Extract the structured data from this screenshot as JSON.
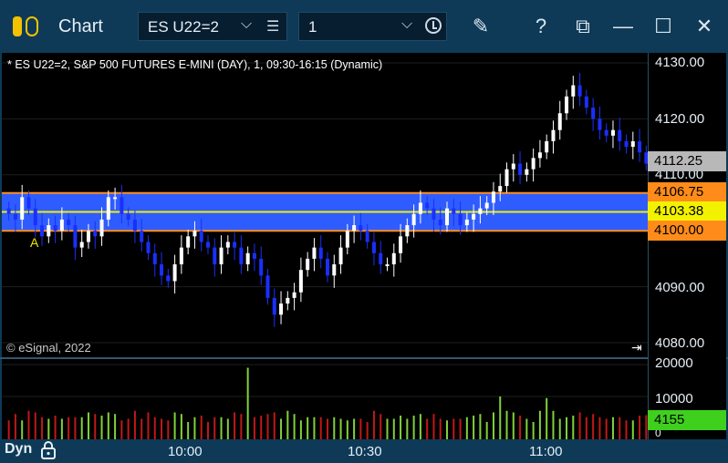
{
  "app": {
    "title": "Chart",
    "symbol": "ES U22=2",
    "interval": "1",
    "icons": [
      "pencil-icon",
      "help-icon",
      "window-icon",
      "minimize-icon",
      "maximize-icon",
      "close-icon"
    ]
  },
  "chart": {
    "caption": "* ES U22=2, S&P 500 FUTURES E-MINI (DAY), 1, 09:30-16:15 (Dynamic)",
    "copyright": "© eSignal, 2022",
    "marker": "A",
    "mode_label": "Dyn",
    "price_ticks": [
      "4130.00",
      "4120.00",
      "4110.00",
      "4090.00",
      "4080.00"
    ],
    "volume_ticks": [
      "20000",
      "10000",
      "0"
    ],
    "time_labels": [
      "10:00",
      "10:30",
      "11:00"
    ],
    "badges": {
      "last": "4112.25",
      "upper": "4106.75",
      "mid": "4103.38",
      "lower": "4100.00",
      "volume": "4155"
    },
    "colors": {
      "band": "#2f5cff",
      "band_edge": "#ff8c1a",
      "midline": "#f2f200",
      "up": "#ffffff",
      "down": "#1a2fff",
      "vol_up": "#7fd23a",
      "vol_down": "#c01818"
    }
  },
  "chart_data": {
    "type": "candlestick",
    "title": "* ES U22=2, S&P 500 FUTURES E-MINI (DAY), 1, 09:30-16:15 (Dynamic)",
    "ylim": [
      4079,
      4131
    ],
    "x": [
      "09:38",
      "09:39",
      "09:40",
      "09:41",
      "09:42",
      "09:43",
      "09:44",
      "09:45",
      "09:46",
      "09:47",
      "09:48",
      "09:49",
      "09:50",
      "09:51",
      "09:52",
      "09:53",
      "09:54",
      "09:55",
      "09:56",
      "09:57",
      "09:58",
      "09:59",
      "10:00",
      "10:01",
      "10:02",
      "10:03",
      "10:04",
      "10:05",
      "10:06",
      "10:07",
      "10:08",
      "10:09",
      "10:10",
      "10:11",
      "10:12",
      "10:13",
      "10:14",
      "10:15",
      "10:16",
      "10:17",
      "10:18",
      "10:19",
      "10:20",
      "10:21",
      "10:22",
      "10:23",
      "10:24",
      "10:25",
      "10:26",
      "10:27",
      "10:28",
      "10:29",
      "10:30",
      "10:31",
      "10:32",
      "10:33",
      "10:34",
      "10:35",
      "10:36",
      "10:37",
      "10:38",
      "10:39",
      "10:40",
      "10:41",
      "10:42",
      "10:43",
      "10:44",
      "10:45",
      "10:46",
      "10:47",
      "10:48",
      "10:49",
      "10:50",
      "10:51",
      "10:52",
      "10:53",
      "10:54",
      "10:55",
      "10:56",
      "10:57",
      "10:58",
      "10:59",
      "11:00",
      "11:01",
      "11:02",
      "11:03",
      "11:04",
      "11:05",
      "11:06",
      "11:07",
      "11:08",
      "11:09",
      "11:10",
      "11:11",
      "11:12",
      "11:13",
      "11:14"
    ],
    "close": [
      4103,
      4102,
      4106,
      4104,
      4101,
      4099,
      4101,
      4100,
      4102,
      4101,
      4097,
      4098,
      4100,
      4099,
      4102,
      4106,
      4106,
      4103,
      4102,
      4100,
      4098,
      4096,
      4094,
      4092,
      4091,
      4094,
      4097,
      4099,
      4100,
      4098,
      4097,
      4094,
      4097,
      4098,
      4097,
      4094,
      4096,
      4095,
      4092,
      4088,
      4085,
      4087,
      4088,
      4089,
      4093,
      4095,
      4097,
      4095,
      4092,
      4094,
      4097,
      4100,
      4101,
      4100,
      4098,
      4096,
      4094,
      4094,
      4096,
      4099,
      4101,
      4103,
      4105,
      4104,
      4102,
      4101,
      4104,
      4103,
      4101,
      4102,
      4103,
      4104,
      4105,
      4107,
      4108,
      4111,
      4112,
      4110,
      4111,
      4113,
      4114,
      4116,
      4118,
      4121,
      4124,
      4126,
      4124,
      4122,
      4120,
      4118,
      4117,
      4118,
      4116,
      4115,
      4116,
      4114,
      4112
    ],
    "volume": [
      2500,
      4500,
      2500,
      5500,
      5000,
      3500,
      3000,
      4000,
      3000,
      3500,
      3500,
      3500,
      5000,
      4500,
      4000,
      5000,
      4500,
      2500,
      3000,
      5500,
      3000,
      5000,
      3500,
      3000,
      2500,
      5000,
      4500,
      2000,
      3500,
      4000,
      2000,
      3500,
      3500,
      3000,
      5000,
      4500,
      19000,
      3500,
      4000,
      4500,
      5000,
      3000,
      5500,
      4500,
      2500,
      3500,
      3500,
      3500,
      3000,
      3500,
      3000,
      2500,
      3000,
      3000,
      2000,
      5500,
      4500,
      3000,
      3000,
      4000,
      3000,
      4000,
      4500,
      3000,
      4500,
      3000,
      2500,
      3000,
      3000,
      3500,
      4000,
      4500,
      2000,
      5000,
      10000,
      5500,
      5000,
      4000,
      3000,
      2000,
      5500,
      9500,
      5500,
      3000,
      3500,
      4000,
      5000,
      3500,
      4500,
      3500,
      3000,
      3500,
      3500,
      2500,
      2500,
      4000,
      4155
    ],
    "overlay_lines": {
      "upper": 4106.75,
      "mid": 4103.38,
      "lower": 4100.0
    },
    "last_price": 4112.25
  }
}
